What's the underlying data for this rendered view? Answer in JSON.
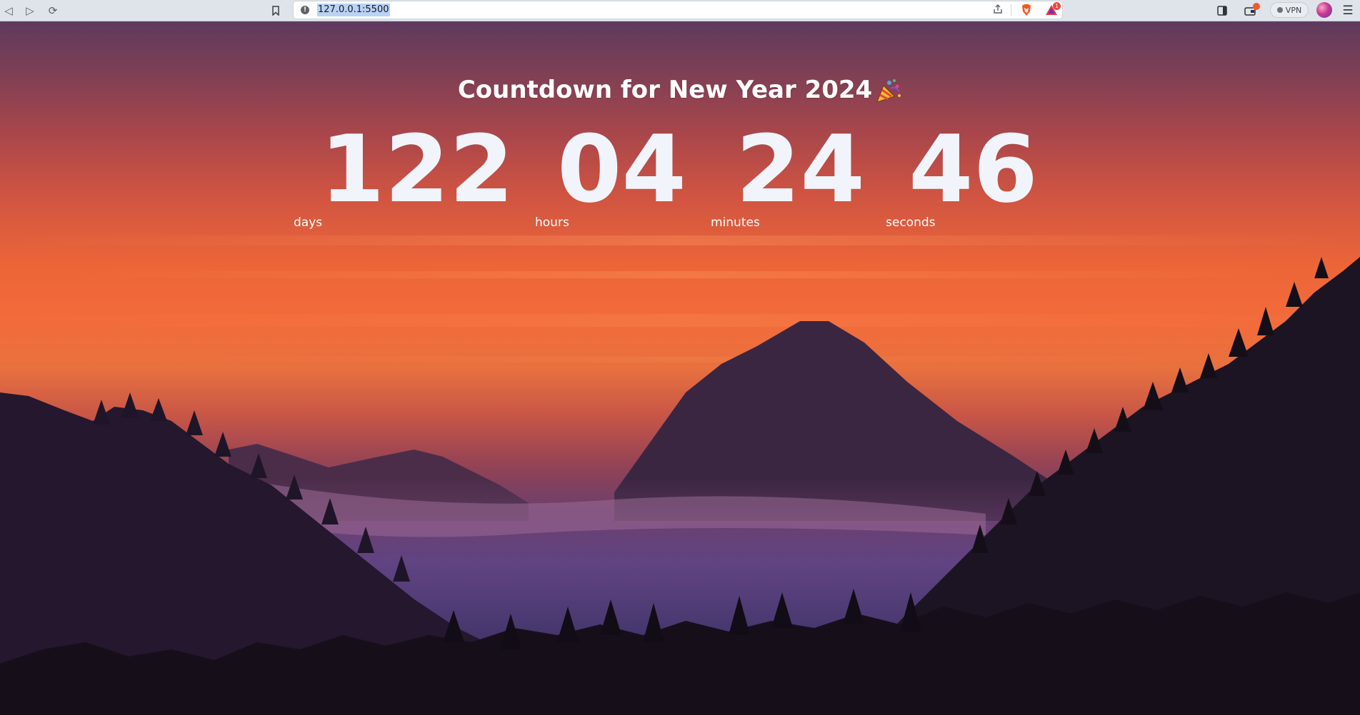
{
  "browser": {
    "url": "127.0.0.1:5500",
    "vpn_label": "VPN",
    "rewards_count": "1"
  },
  "page": {
    "title": "Countdown for New Year 2024",
    "countdown": [
      {
        "value": "122",
        "label": "days"
      },
      {
        "value": "04",
        "label": "hours"
      },
      {
        "value": "24",
        "label": "minutes"
      },
      {
        "value": "46",
        "label": "seconds"
      }
    ]
  },
  "icons": {
    "title_emoji": "party-popper-icon"
  },
  "colors": {
    "text": "#ffffff",
    "number": "#f1f5fb",
    "sky_top": "#5e3a5e",
    "sky_glow": "#f36b3a",
    "mountains": "#2a1d33"
  }
}
